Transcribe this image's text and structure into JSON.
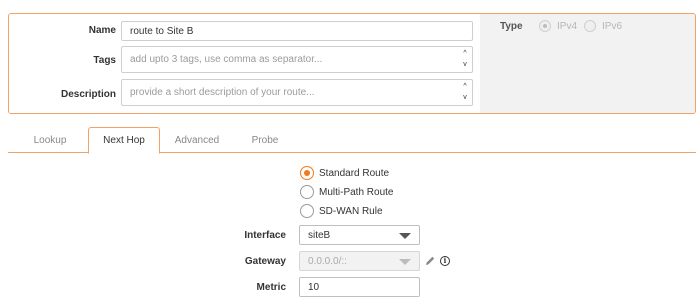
{
  "form": {
    "name_label": "Name",
    "name_value": "route to Site B",
    "tags_label": "Tags",
    "tags_placeholder": "add upto 3 tags, use comma as separator...",
    "description_label": "Description",
    "description_placeholder": "provide a short description of your route...",
    "scroll_up": "^",
    "scroll_down": "v",
    "type_label": "Type",
    "type_options": [
      {
        "label": "IPv4",
        "selected": true
      },
      {
        "label": "IPv6",
        "selected": false
      }
    ]
  },
  "tabs": [
    {
      "label": "Lookup"
    },
    {
      "label": "Next Hop"
    },
    {
      "label": "Advanced"
    },
    {
      "label": "Probe"
    }
  ],
  "active_tab": "Next Hop",
  "route_types": [
    {
      "label": "Standard Route",
      "selected": true
    },
    {
      "label": "Multi-Path Route",
      "selected": false
    },
    {
      "label": "SD-WAN Rule",
      "selected": false
    }
  ],
  "next_hop": {
    "interface_label": "Interface",
    "interface_value": "siteB",
    "gateway_label": "Gateway",
    "gateway_value": "0.0.0.0/::",
    "metric_label": "Metric",
    "metric_value": "10",
    "info_glyph": "i"
  },
  "colors": {
    "accent": "#f07a1e",
    "border_accent": "#f3a266",
    "panel_gray": "#f2f2f2"
  }
}
